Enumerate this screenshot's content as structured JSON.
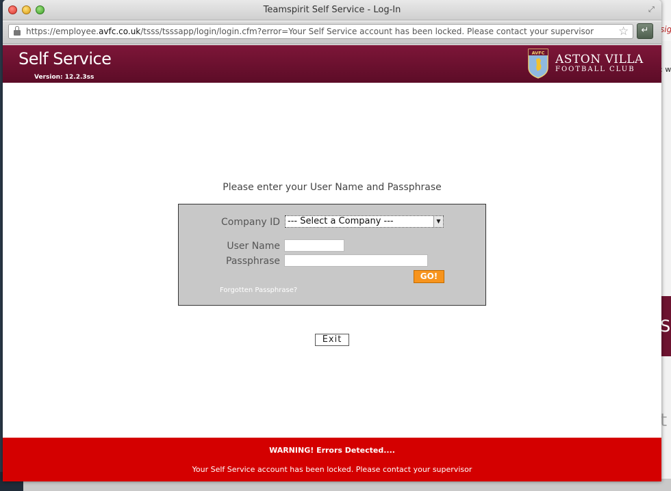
{
  "window": {
    "title": "Teamspirit Self Service - Log-In",
    "url_prefix": "https://employee.",
    "url_domain": "avfc.co.uk",
    "url_path": "/tsss/tsssapp/login/login.cfm?error=Your Self Service account has been locked.  Please contact your supervisor"
  },
  "header": {
    "app_title": "Self Service",
    "version": "Version: 12.2.3ss",
    "crest_text": "AVFC",
    "club_name": "ASTON VILLA",
    "club_subtitle": "FOOTBALL CLUB"
  },
  "login": {
    "prompt": "Please enter your User Name and Passphrase",
    "company_label": "Company ID",
    "company_selected": "--- Select a Company ---",
    "username_label": "User Name",
    "username_value": "",
    "passphrase_label": "Passphrase",
    "passphrase_value": "",
    "submit_label": "GO!",
    "forgot_label": "Forgotten Passphrase?"
  },
  "exit_label": "Exit",
  "warning": {
    "title": "WARNING! Errors Detected....",
    "message": "Your Self Service account has been locked. Please contact your supervisor"
  },
  "background": {
    "fragment1": "sig",
    "fragment2": ": w",
    "fragment3": "Se",
    "fragment4": "t"
  },
  "colors": {
    "header_maroon": "#6d1330",
    "warning_red": "#d40000",
    "go_orange": "#f7941d",
    "box_grey": "#c8c8c8"
  }
}
